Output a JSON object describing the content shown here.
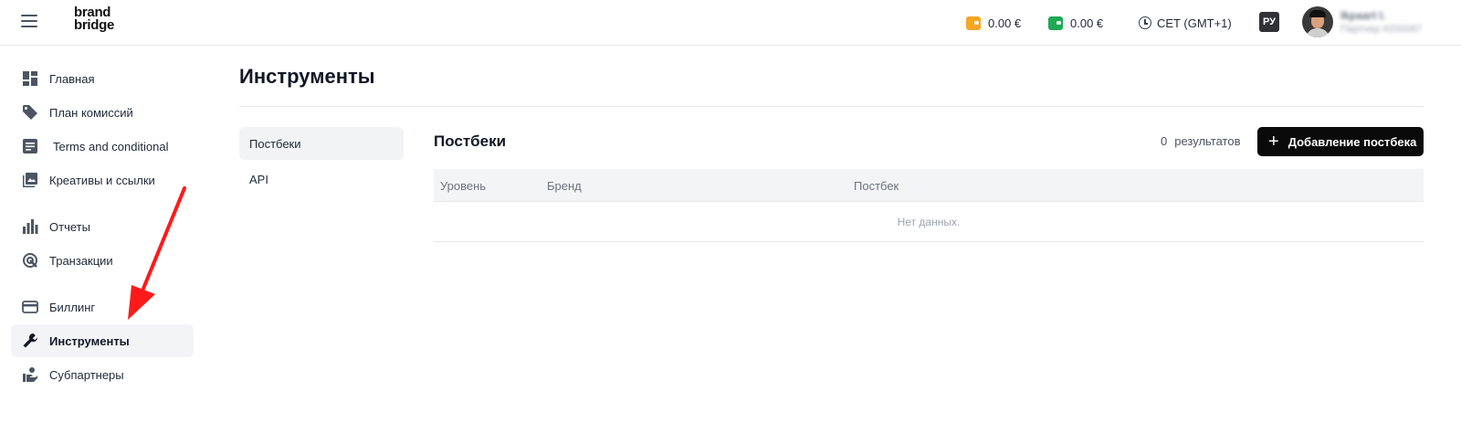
{
  "header": {
    "logo_line1": "brand",
    "logo_line2": "bridge",
    "balance1": "0.00 €",
    "balance1_color": "#f5a623",
    "balance2": "0.00 €",
    "balance2_color": "#1fa855",
    "timezone": "CET (GMT+1)",
    "language": "РУ",
    "user_name": "Ikpaart I.",
    "user_id": "Партнер #200087"
  },
  "sidebar": {
    "items": [
      {
        "label": "Главная",
        "icon": "dashboard-icon"
      },
      {
        "label": "План комиссий",
        "icon": "tag-icon"
      },
      {
        "label": "Terms and conditional",
        "icon": "document-icon"
      },
      {
        "label": "Креативы и ссылки",
        "icon": "image-icon"
      },
      {
        "label": "Отчеты",
        "icon": "bar-chart-icon"
      },
      {
        "label": "Транзакции",
        "icon": "transactions-icon"
      },
      {
        "label": "Биллинг",
        "icon": "credit-card-icon"
      },
      {
        "label": "Инструменты",
        "icon": "wrench-icon",
        "active": true
      },
      {
        "label": "Субпартнеры",
        "icon": "subpartners-icon"
      }
    ]
  },
  "main": {
    "title": "Инструменты",
    "subnav": [
      {
        "label": "Постбеки",
        "active": true
      },
      {
        "label": "API"
      }
    ],
    "section_title": "Постбеки",
    "results_count": "0",
    "results_label": "результатов",
    "add_button": "Добавление постбека",
    "table": {
      "columns": [
        "Уровень",
        "Бренд",
        "Постбек"
      ],
      "empty_text": "Нет данных."
    }
  },
  "colors": {
    "accent": "#0a0a0a",
    "annotation_arrow": "#ff1a1a"
  }
}
